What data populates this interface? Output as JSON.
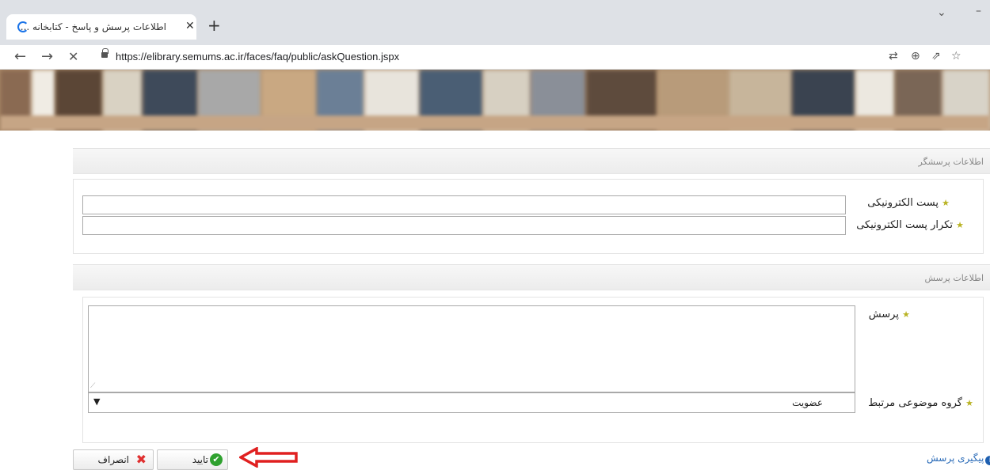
{
  "browser": {
    "tab_title": "اطلاعات پرسش و پاسخ - کتابخانه ...",
    "tab_close": "✕",
    "new_tab": "+",
    "url": "https://elibrary.semums.ac.ir/faces/faq/public/askQuestion.jspx",
    "back": "←",
    "forward": "→",
    "stop": "✕",
    "tools": {
      "translate": "⇄",
      "zoom": "⊕",
      "share": "⇗",
      "bookmark": "☆"
    },
    "window_chevron": "⌄",
    "window_minimize": "–"
  },
  "asker_section": {
    "title": "اطلاعات پرسشگر",
    "email_label": "پست الکترونیکی",
    "email_value": "",
    "email_repeat_label": "تکرار پست الکترونیکی",
    "email_repeat_value": ""
  },
  "question_section": {
    "title": "اطلاعات پرسش",
    "question_label": "پرسش",
    "question_value": "",
    "topic_label": "گروه موضوعی مرتبط",
    "topic_value": "عضویت"
  },
  "required_star": "★",
  "actions": {
    "cancel_label": "انصراف",
    "confirm_label": "تایید",
    "follow_label": "پیگیری پرسش"
  },
  "icons": {
    "cancel": "x-icon",
    "confirm": "check-circle-icon",
    "follow": "info-icon",
    "annotation": "arrow-left-icon"
  }
}
